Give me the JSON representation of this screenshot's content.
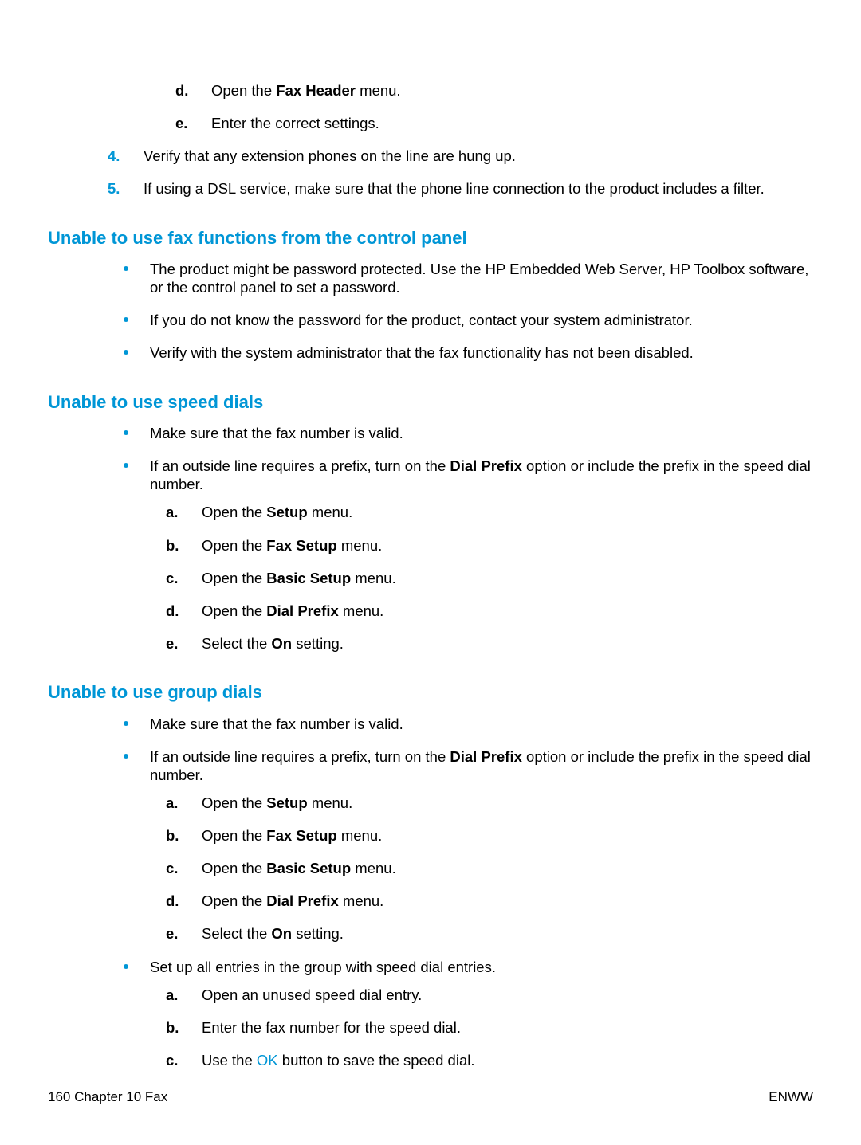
{
  "intro_sub": {
    "d_pre": "Open the ",
    "d_bold": "Fax Header",
    "d_post": " menu.",
    "e": "Enter the correct settings."
  },
  "intro_num": {
    "n4": "Verify that any extension phones on the line are hung up.",
    "n5": "If using a DSL service, make sure that the phone line connection to the product includes a filter."
  },
  "sec1": {
    "title": "Unable to use fax functions from the control panel",
    "b1": "The product might be password protected. Use the HP Embedded Web Server, HP Toolbox software, or the control panel to set a password.",
    "b2": "If you do not know the password for the product, contact your system administrator.",
    "b3": "Verify with the system administrator that the fax functionality has not been disabled."
  },
  "sec2": {
    "title": "Unable to use speed dials",
    "b1": "Make sure that the fax number is valid.",
    "b2_pre": "If an outside line requires a prefix, turn on the ",
    "b2_bold": "Dial Prefix",
    "b2_post": " option or include the prefix in the speed dial number.",
    "sa_pre": "Open the ",
    "sa_bold": "Setup",
    "sa_post": " menu.",
    "sb_pre": "Open the ",
    "sb_bold": "Fax Setup",
    "sb_post": " menu.",
    "sc_pre": "Open the ",
    "sc_bold": "Basic Setup",
    "sc_post": " menu.",
    "sd_pre": "Open the ",
    "sd_bold": "Dial Prefix",
    "sd_post": " menu.",
    "se_pre": "Select the ",
    "se_bold": "On",
    "se_post": " setting."
  },
  "sec3": {
    "title": "Unable to use group dials",
    "b1": "Make sure that the fax number is valid.",
    "b2_pre": "If an outside line requires a prefix, turn on the ",
    "b2_bold": "Dial Prefix",
    "b2_post": " option or include the prefix in the speed dial number.",
    "sa_pre": "Open the ",
    "sa_bold": "Setup",
    "sa_post": " menu.",
    "sb_pre": "Open the ",
    "sb_bold": "Fax Setup",
    "sb_post": " menu.",
    "sc_pre": "Open the ",
    "sc_bold": "Basic Setup",
    "sc_post": " menu.",
    "sd_pre": "Open the ",
    "sd_bold": "Dial Prefix",
    "sd_post": " menu.",
    "se_pre": "Select the ",
    "se_bold": "On",
    "se_post": " setting.",
    "b3": "Set up all entries in the group with speed dial entries.",
    "g_a": "Open an unused speed dial entry.",
    "g_b": "Enter the fax number for the speed dial.",
    "g_c_pre": "Use the ",
    "g_c_ok": "OK",
    "g_c_post": " button to save the speed dial."
  },
  "footer": {
    "left": "160   Chapter 10   Fax",
    "right": "ENWW"
  }
}
